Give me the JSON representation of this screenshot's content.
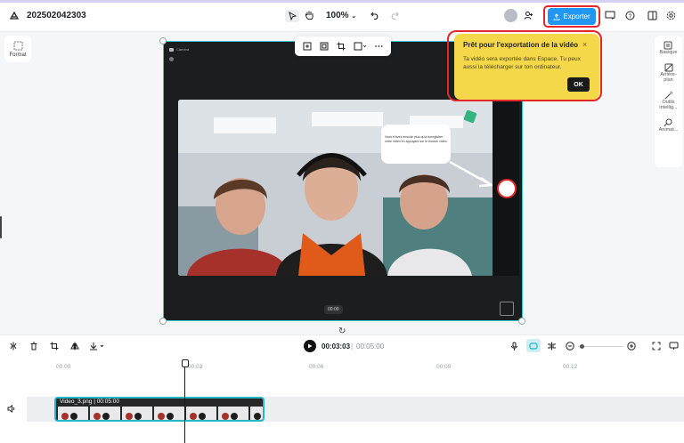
{
  "app": {
    "project_title": "202502042303",
    "zoom": "100%"
  },
  "header": {
    "export_label": "Exporter"
  },
  "tooltip": {
    "title": "Prêt pour l'exportation de la vidéo",
    "body": "Ta vidéo sera exportée dans Espace. Tu peux aussi la télécharger sur ton ordinateur.",
    "ok_label": "OK",
    "close_glyph": "×"
  },
  "left_panel": {
    "format_label": "Format"
  },
  "right_panel": {
    "items": [
      {
        "label": "Basique",
        "icon": "sliders-icon"
      },
      {
        "label": "Arrière-plan",
        "icon": "background-icon"
      },
      {
        "label": "Outils intellig...",
        "icon": "magic-wand-icon"
      },
      {
        "label": "Animat...",
        "icon": "animation-icon"
      }
    ]
  },
  "canvas": {
    "recording_label": "Caméra",
    "speech_bubble": "Vous n'avez ensuite plus qu'à enregistrer votre vidéo en appuyant sur le bouton vidéo",
    "video_time": "00:00"
  },
  "playback": {
    "current": "00:03:03",
    "separator": "|",
    "total": "00:05:00"
  },
  "timeline": {
    "ticks": [
      "00:00",
      "00:03",
      "00:06",
      "00:09",
      "00:12"
    ],
    "clip_label": "Video_3.png | 00:05:00"
  },
  "colors": {
    "accent": "#2196f3",
    "highlight": "#e2262b",
    "tooltip_bg": "#f5d84a",
    "selection": "#22b8c5"
  }
}
